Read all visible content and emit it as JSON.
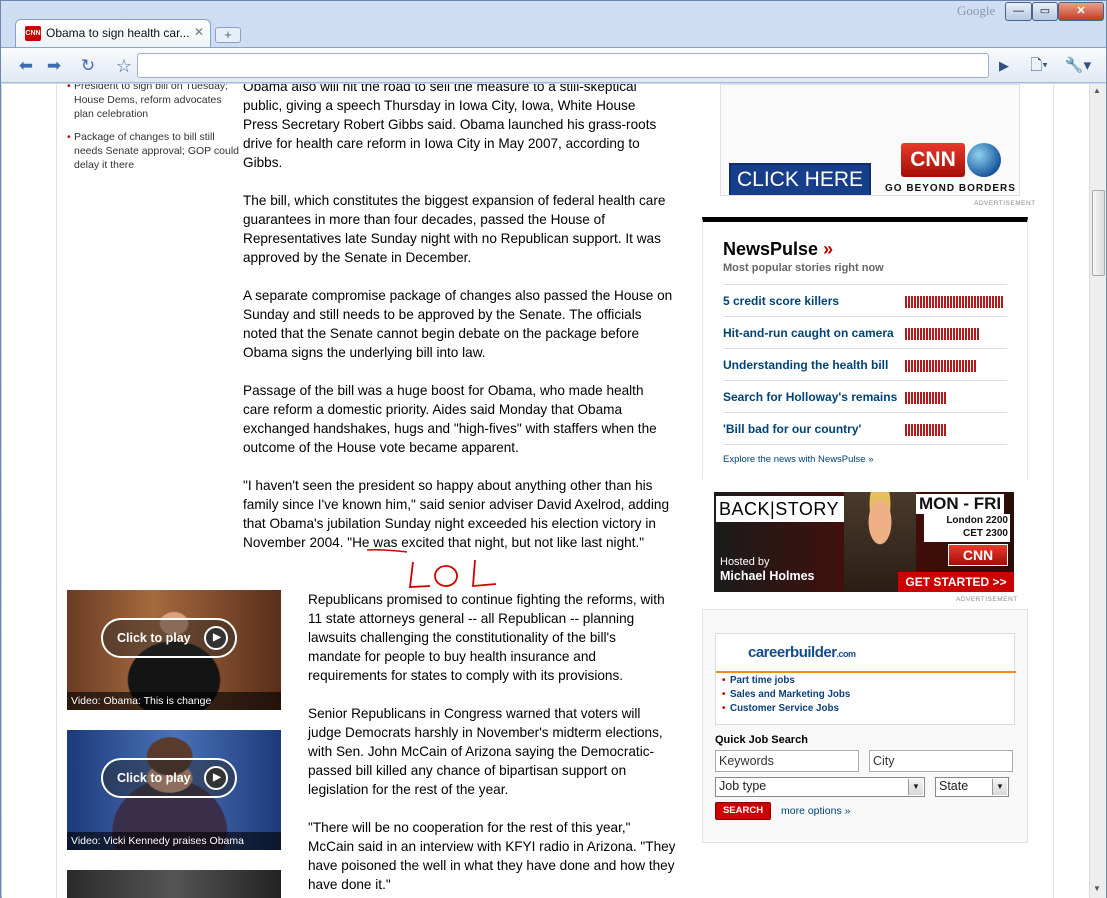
{
  "browser": {
    "tab_title": "Obama to sign health car...",
    "tab_favicon": "CNN",
    "brand": "Google",
    "omnibox_value": "",
    "accent": "#3d6cb0"
  },
  "related": [
    "President to sign bill on Tuesday; House Dems, reform advocates plan celebration",
    "Package of changes to bill still needs Senate approval; GOP could delay it there"
  ],
  "article": {
    "paragraphs": [
      "Obama also will hit the road to sell the measure to a still-skeptical public, giving a speech Thursday in Iowa City, Iowa, White House Press Secretary Robert Gibbs said. Obama launched his grass-roots drive for health care reform in Iowa City in May 2007, according to Gibbs.",
      "The bill, which constitutes the biggest expansion of federal health care guarantees in more than four decades, passed the House of Representatives late Sunday night with no Republican support. It was approved by the Senate in December.",
      "A separate compromise package of changes also passed the House on Sunday and still needs to be approved by the Senate. The officials noted that the Senate cannot begin debate on the package before Obama signs the underlying bill into law.",
      "Passage of the bill was a huge boost for Obama, who made health care reform a domestic priority. Aides said Monday that Obama exchanged handshakes, hugs and \"high-fives\" with staffers when the outcome of the House vote became apparent.",
      "\"I haven't seen the president so happy about anything other than his family since I've known him,\" said senior adviser David Axelrod, adding that Obama's jubilation Sunday night exceeded his election victory in November 2004. \"He was excited that night, but not like last night.\"",
      "Republicans promised to continue fighting the reforms, with 11 state attorneys general -- all Republican -- planning lawsuits challenging the constitutionality of the bill's mandate for people to buy health insurance and requirements for states to comply with its provisions.",
      "Senior Republicans in Congress warned that voters will judge Democrats harshly in November's midterm elections, with Sen. John McCain of Arizona saying the Democratic-passed bill killed any chance of bipartisan support on legislation for the rest of the year.",
      "\"There will be no cooperation for the rest of this year,\" McCain said in an interview with KFYI radio in Arizona. \"They have poisoned the well in what they have done and how they have done it.\""
    ],
    "videos": [
      {
        "play": "Click to play",
        "caption": "Video: Obama: This is change"
      },
      {
        "play": "Click to play",
        "caption": "Video: Vicki Kennedy praises Obama"
      }
    ],
    "annotation": "LOL"
  },
  "ad_top": {
    "cta": "CLICK HERE",
    "logo": "CNN",
    "tagline": "GO BEYOND BORDERS",
    "label": "ADVERTISEMENT"
  },
  "newspulse": {
    "title": "NewsPulse",
    "arrow": "»",
    "subtitle": "Most popular stories right now",
    "items": [
      {
        "label": "5 credit score killers",
        "popularity": 1.0
      },
      {
        "label": "Hit-and-run caught on camera",
        "popularity": 0.77
      },
      {
        "label": "Understanding the health bill",
        "popularity": 0.73
      },
      {
        "label": "Search for Holloway's remains",
        "popularity": 0.43
      },
      {
        "label": "'Bill bad for our country'",
        "popularity": 0.43
      }
    ],
    "explore": "Explore the news with NewsPulse »"
  },
  "backstory": {
    "logo": "BACK|STORY",
    "days": "MON - FRI",
    "time1": "London 2200",
    "time2": "CET 2300",
    "channel": "CNN",
    "hosted": "Hosted by",
    "host": "Michael Holmes",
    "cta": "GET STARTED >>",
    "label": "ADVERTISEMENT"
  },
  "careerbuilder": {
    "logo": "careerbuilder",
    "logo_suffix": ".com",
    "links": [
      "Part time jobs",
      "Sales and Marketing Jobs",
      "Customer Service Jobs"
    ],
    "quick_title": "Quick Job Search",
    "keywords_value": "Keywords",
    "city_value": "City",
    "jobtype_value": "Job type",
    "state_value": "State",
    "search_label": "SEARCH",
    "more_options": "more options »"
  }
}
